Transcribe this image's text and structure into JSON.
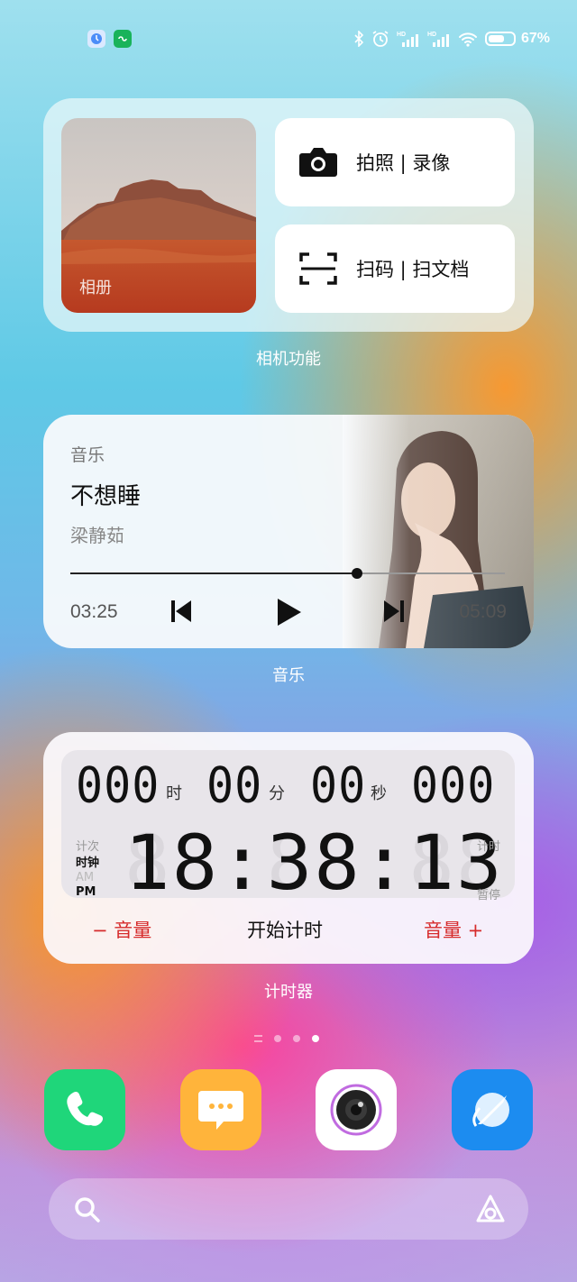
{
  "status_bar": {
    "battery_text": "67%",
    "battery_level": 0.67,
    "left_icons": [
      "clock-app-icon",
      "link-app-icon"
    ],
    "right_icons": [
      "bluetooth-icon",
      "alarm-icon",
      "signal-hd-icon",
      "signal-hd-icon",
      "wifi-icon",
      "battery-icon"
    ]
  },
  "camera_widget": {
    "album_label": "相册",
    "photo_button_label": "拍照 | 录像",
    "scan_button_label": "扫码 | 扫文档",
    "caption": "相机功能"
  },
  "music_widget": {
    "header": "音乐",
    "song_title": "不想睡",
    "artist": "梁静茹",
    "elapsed": "03:25",
    "total": "05:09",
    "progress": 0.66,
    "caption": "音乐"
  },
  "timer_widget": {
    "stopwatch": {
      "hours": "000",
      "hours_unit": "时",
      "minutes": "00",
      "minutes_unit": "分",
      "seconds": "00",
      "seconds_unit": "秒",
      "millis": "000"
    },
    "left_labels": {
      "lap": "计次",
      "clock": "时钟",
      "am": "AM",
      "pm": "PM"
    },
    "right_labels": {
      "timing": "计时",
      "pause": "暂停"
    },
    "clock_ghost": "88:88:88",
    "clock_time": "18:38:13",
    "vol_down_label": "− 音量",
    "start_label": "开始计时",
    "vol_up_label": "音量 +",
    "caption": "计时器"
  },
  "page_indicator": {
    "count": 4,
    "active_index": 3
  },
  "dock": {
    "apps": [
      {
        "name": "phone",
        "color": "#1fd67a"
      },
      {
        "name": "messages",
        "color": "#ffb43b"
      },
      {
        "name": "camera",
        "color": "#ffffff"
      },
      {
        "name": "browser",
        "color": "#1c8cf0"
      }
    ]
  },
  "colors": {
    "accent_red": "#d62b2b"
  }
}
